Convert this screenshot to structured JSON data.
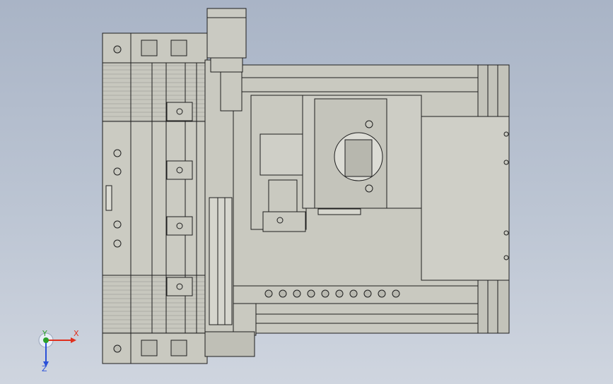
{
  "viewport": {
    "background_top": "#a9b4c6",
    "background_bottom": "#cfd5df",
    "part_fill": "#c9c9c0",
    "part_stroke": "#1e1e1e"
  },
  "triad": {
    "x_label": "X",
    "y_label": "Y",
    "z_label": "Z",
    "x_color": "#e0301e",
    "y_color": "#2aa02a",
    "z_color": "#2a50d8"
  }
}
